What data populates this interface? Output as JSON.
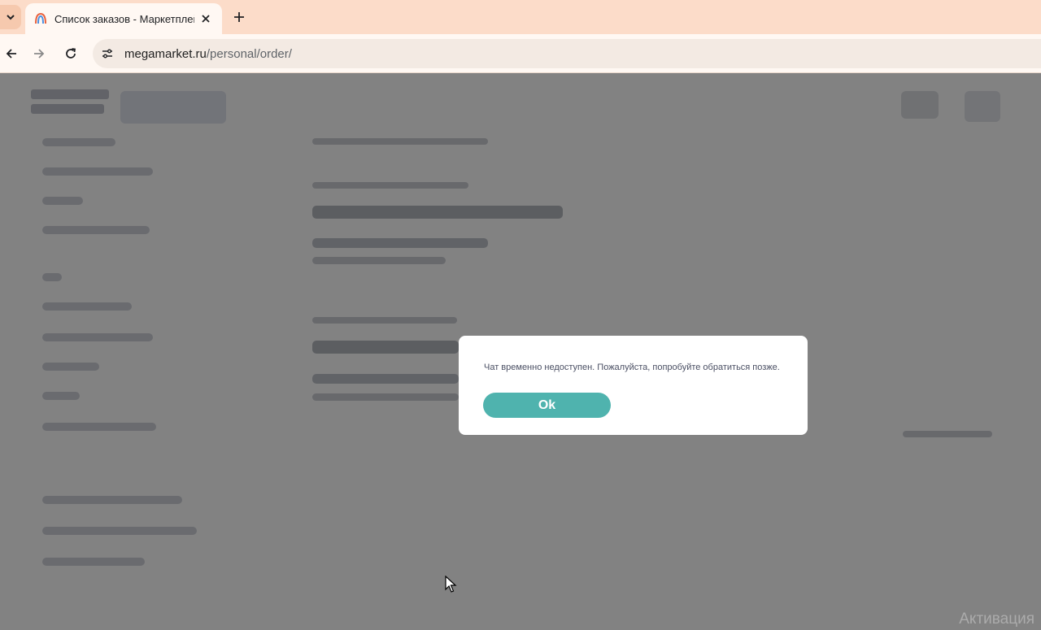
{
  "browser": {
    "tab": {
      "title": "Список заказов - Маркетплей"
    },
    "address": {
      "host": "megamarket.ru",
      "path": "/personal/order/"
    }
  },
  "modal": {
    "message": "Чат временно недоступен. Пожалуйста, попробуйте обратиться позже.",
    "ok_label": "Ok"
  },
  "system": {
    "watermark": "Активация"
  },
  "colors": {
    "tabbar": "#fcdcc9",
    "accent_button": "#4fb3ae",
    "overlay": "rgba(0,0,0,0.47)"
  },
  "icons": [
    "tab-list-icon",
    "favicon-icon",
    "close-icon",
    "plus-icon",
    "back-arrow-icon",
    "forward-arrow-icon",
    "reload-icon",
    "site-settings-icon",
    "cursor-icon"
  ]
}
